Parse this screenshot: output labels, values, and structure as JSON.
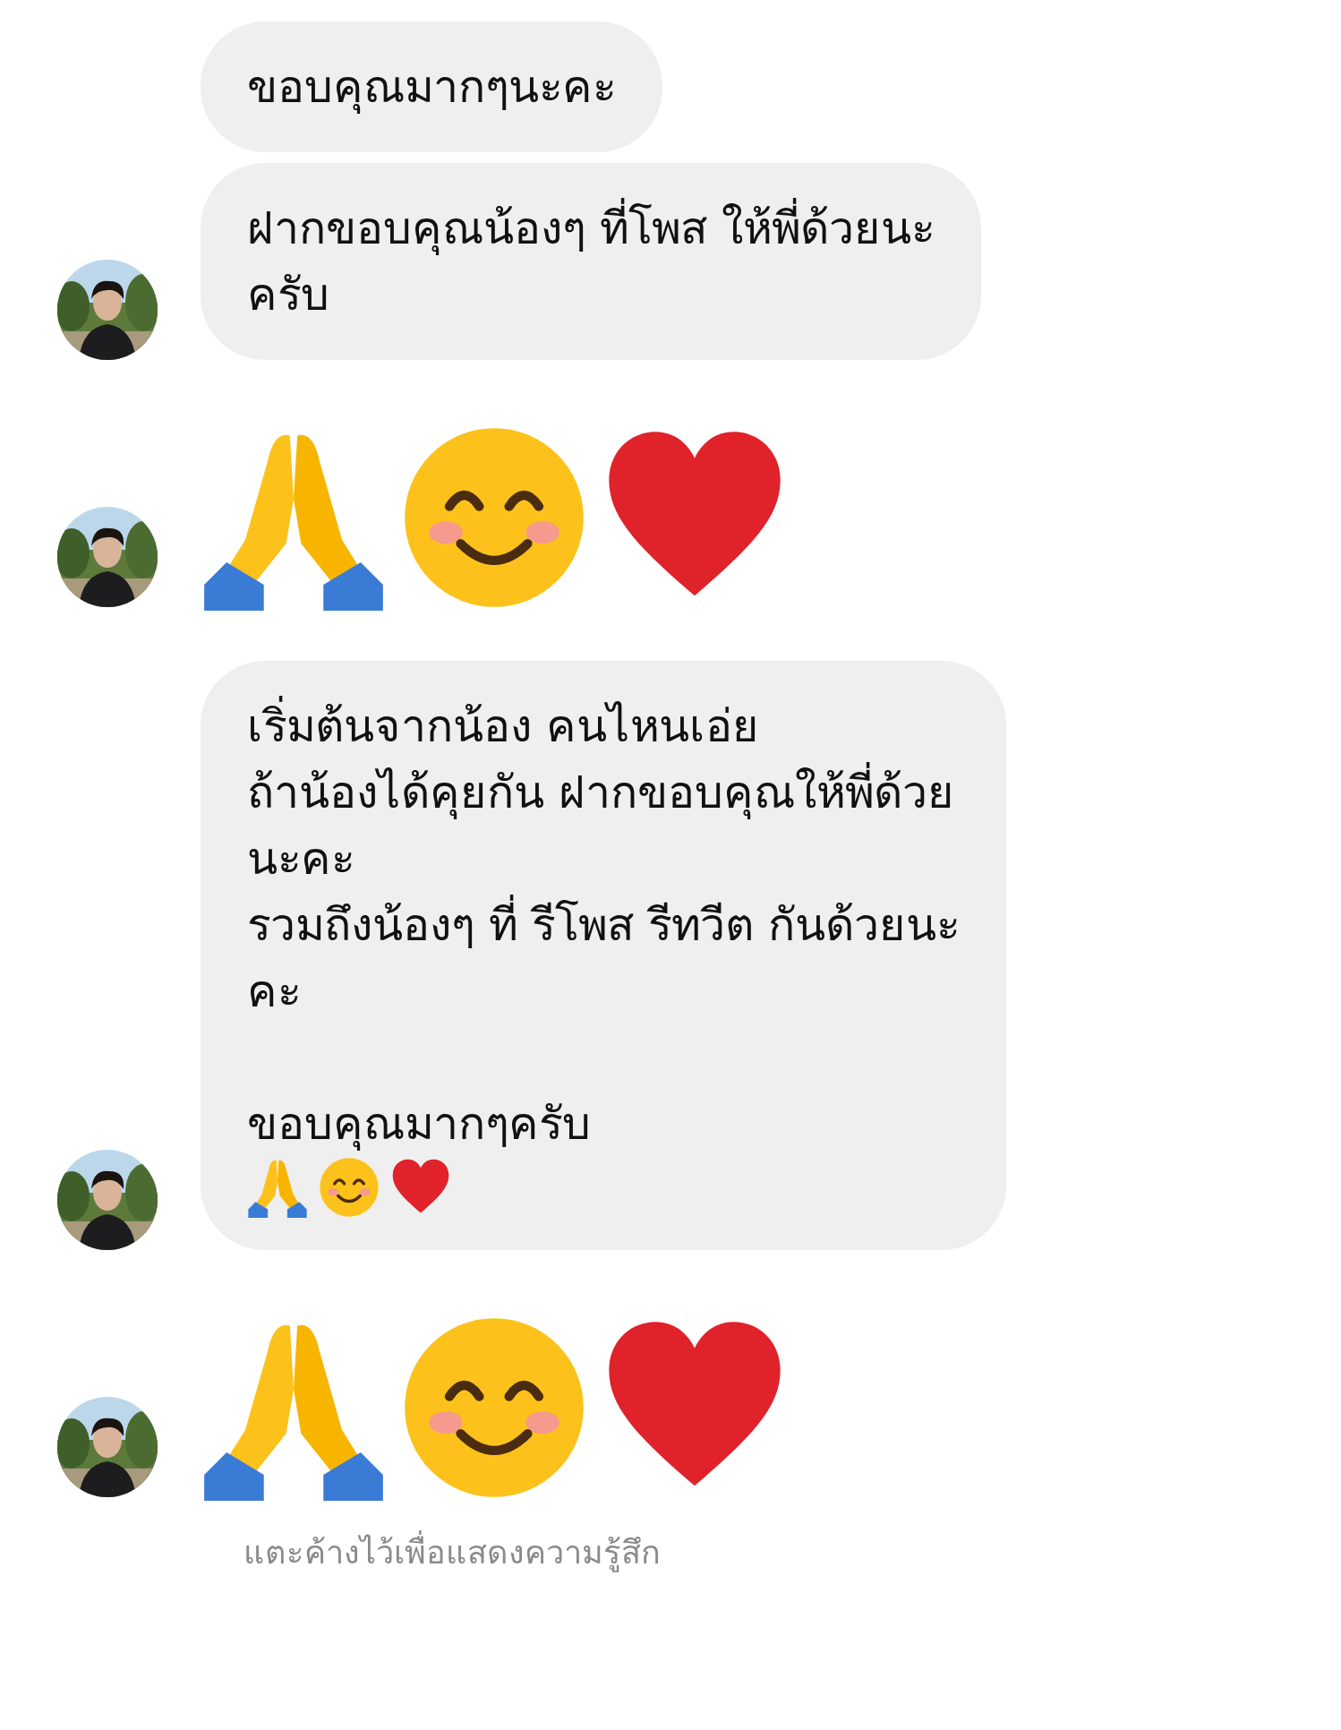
{
  "messages": [
    {
      "kind": "bubble",
      "avatar": false,
      "lines": [
        {
          "kind": "text",
          "text": "ขอบคุณมากๆนะคะ"
        }
      ]
    },
    {
      "kind": "bubble",
      "avatar": true,
      "lines": [
        {
          "kind": "text",
          "text": "ฝากขอบคุณน้องๆ ที่โพส ให้พี่ด้วยนะ"
        },
        {
          "kind": "text",
          "text": "ครับ"
        }
      ]
    },
    {
      "kind": "emojis",
      "avatar": true
    },
    {
      "kind": "bubble",
      "avatar": true,
      "lines": [
        {
          "kind": "text",
          "text": "เริ่มต้นจากน้อง คนไหนเอ่ย"
        },
        {
          "kind": "text",
          "text": "ถ้าน้องได้คุยกัน ฝากขอบคุณให้พี่ด้วย"
        },
        {
          "kind": "text",
          "text": "นะคะ"
        },
        {
          "kind": "text",
          "text": "รวมถึงน้องๆ ที่ รีโพส รีทวีต กันด้วยนะ"
        },
        {
          "kind": "text",
          "text": "คะ"
        },
        {
          "kind": "blank"
        },
        {
          "kind": "text",
          "text": "ขอบคุณมากๆครับ"
        },
        {
          "kind": "emojis"
        }
      ]
    },
    {
      "kind": "emojis",
      "avatar": true
    }
  ],
  "hint": "แตะค้างไว้เพื่อแสดงความรู้สึก"
}
